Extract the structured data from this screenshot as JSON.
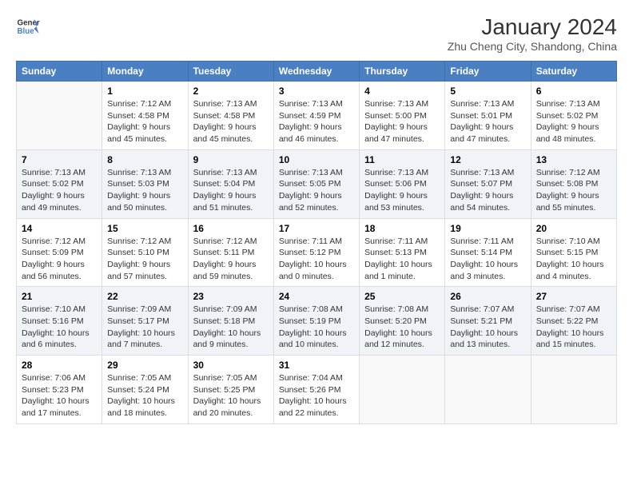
{
  "logo": {
    "line1": "General",
    "line2": "Blue"
  },
  "title": "January 2024",
  "subtitle": "Zhu Cheng City, Shandong, China",
  "days_of_week": [
    "Sunday",
    "Monday",
    "Tuesday",
    "Wednesday",
    "Thursday",
    "Friday",
    "Saturday"
  ],
  "weeks": [
    [
      {
        "num": "",
        "info": ""
      },
      {
        "num": "1",
        "info": "Sunrise: 7:12 AM\nSunset: 4:58 PM\nDaylight: 9 hours\nand 45 minutes."
      },
      {
        "num": "2",
        "info": "Sunrise: 7:13 AM\nSunset: 4:58 PM\nDaylight: 9 hours\nand 45 minutes."
      },
      {
        "num": "3",
        "info": "Sunrise: 7:13 AM\nSunset: 4:59 PM\nDaylight: 9 hours\nand 46 minutes."
      },
      {
        "num": "4",
        "info": "Sunrise: 7:13 AM\nSunset: 5:00 PM\nDaylight: 9 hours\nand 47 minutes."
      },
      {
        "num": "5",
        "info": "Sunrise: 7:13 AM\nSunset: 5:01 PM\nDaylight: 9 hours\nand 47 minutes."
      },
      {
        "num": "6",
        "info": "Sunrise: 7:13 AM\nSunset: 5:02 PM\nDaylight: 9 hours\nand 48 minutes."
      }
    ],
    [
      {
        "num": "7",
        "info": "Sunrise: 7:13 AM\nSunset: 5:02 PM\nDaylight: 9 hours\nand 49 minutes."
      },
      {
        "num": "8",
        "info": "Sunrise: 7:13 AM\nSunset: 5:03 PM\nDaylight: 9 hours\nand 50 minutes."
      },
      {
        "num": "9",
        "info": "Sunrise: 7:13 AM\nSunset: 5:04 PM\nDaylight: 9 hours\nand 51 minutes."
      },
      {
        "num": "10",
        "info": "Sunrise: 7:13 AM\nSunset: 5:05 PM\nDaylight: 9 hours\nand 52 minutes."
      },
      {
        "num": "11",
        "info": "Sunrise: 7:13 AM\nSunset: 5:06 PM\nDaylight: 9 hours\nand 53 minutes."
      },
      {
        "num": "12",
        "info": "Sunrise: 7:13 AM\nSunset: 5:07 PM\nDaylight: 9 hours\nand 54 minutes."
      },
      {
        "num": "13",
        "info": "Sunrise: 7:12 AM\nSunset: 5:08 PM\nDaylight: 9 hours\nand 55 minutes."
      }
    ],
    [
      {
        "num": "14",
        "info": "Sunrise: 7:12 AM\nSunset: 5:09 PM\nDaylight: 9 hours\nand 56 minutes."
      },
      {
        "num": "15",
        "info": "Sunrise: 7:12 AM\nSunset: 5:10 PM\nDaylight: 9 hours\nand 57 minutes."
      },
      {
        "num": "16",
        "info": "Sunrise: 7:12 AM\nSunset: 5:11 PM\nDaylight: 9 hours\nand 59 minutes."
      },
      {
        "num": "17",
        "info": "Sunrise: 7:11 AM\nSunset: 5:12 PM\nDaylight: 10 hours\nand 0 minutes."
      },
      {
        "num": "18",
        "info": "Sunrise: 7:11 AM\nSunset: 5:13 PM\nDaylight: 10 hours\nand 1 minute."
      },
      {
        "num": "19",
        "info": "Sunrise: 7:11 AM\nSunset: 5:14 PM\nDaylight: 10 hours\nand 3 minutes."
      },
      {
        "num": "20",
        "info": "Sunrise: 7:10 AM\nSunset: 5:15 PM\nDaylight: 10 hours\nand 4 minutes."
      }
    ],
    [
      {
        "num": "21",
        "info": "Sunrise: 7:10 AM\nSunset: 5:16 PM\nDaylight: 10 hours\nand 6 minutes."
      },
      {
        "num": "22",
        "info": "Sunrise: 7:09 AM\nSunset: 5:17 PM\nDaylight: 10 hours\nand 7 minutes."
      },
      {
        "num": "23",
        "info": "Sunrise: 7:09 AM\nSunset: 5:18 PM\nDaylight: 10 hours\nand 9 minutes."
      },
      {
        "num": "24",
        "info": "Sunrise: 7:08 AM\nSunset: 5:19 PM\nDaylight: 10 hours\nand 10 minutes."
      },
      {
        "num": "25",
        "info": "Sunrise: 7:08 AM\nSunset: 5:20 PM\nDaylight: 10 hours\nand 12 minutes."
      },
      {
        "num": "26",
        "info": "Sunrise: 7:07 AM\nSunset: 5:21 PM\nDaylight: 10 hours\nand 13 minutes."
      },
      {
        "num": "27",
        "info": "Sunrise: 7:07 AM\nSunset: 5:22 PM\nDaylight: 10 hours\nand 15 minutes."
      }
    ],
    [
      {
        "num": "28",
        "info": "Sunrise: 7:06 AM\nSunset: 5:23 PM\nDaylight: 10 hours\nand 17 minutes."
      },
      {
        "num": "29",
        "info": "Sunrise: 7:05 AM\nSunset: 5:24 PM\nDaylight: 10 hours\nand 18 minutes."
      },
      {
        "num": "30",
        "info": "Sunrise: 7:05 AM\nSunset: 5:25 PM\nDaylight: 10 hours\nand 20 minutes."
      },
      {
        "num": "31",
        "info": "Sunrise: 7:04 AM\nSunset: 5:26 PM\nDaylight: 10 hours\nand 22 minutes."
      },
      {
        "num": "",
        "info": ""
      },
      {
        "num": "",
        "info": ""
      },
      {
        "num": "",
        "info": ""
      }
    ]
  ]
}
